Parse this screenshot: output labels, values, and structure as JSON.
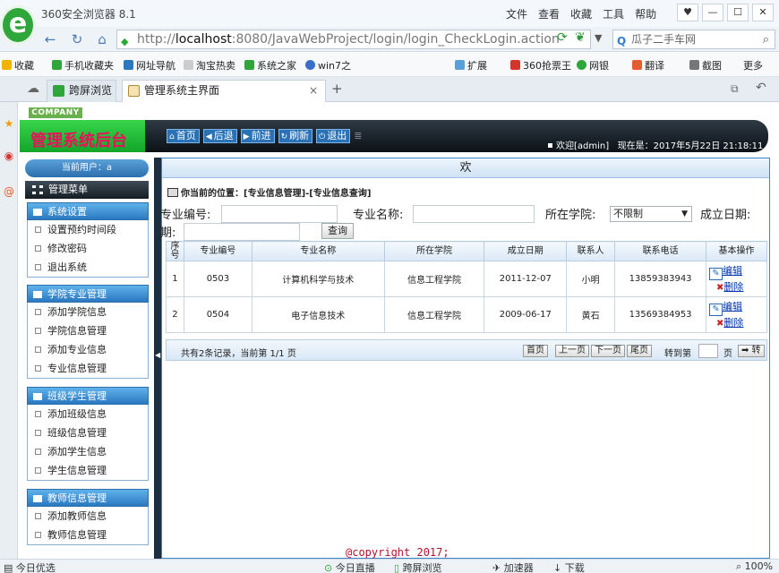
{
  "browser": {
    "app_title": "360安全浏览器 8.1",
    "logo_letter": "e",
    "title_menu": [
      "文件",
      "查看",
      "收藏",
      "工具",
      "帮助"
    ],
    "window_buttons": [
      "♥",
      "—",
      "☐",
      "✕"
    ],
    "address": {
      "scheme": "http://",
      "host": "localhost",
      "rest": ":8080/JavaWebProject/login/login_CheckLogin.action"
    },
    "search_text": "瓜子二手车网",
    "bookmarks": [
      "收藏",
      "手机收藏夹",
      "网址导航",
      "淘宝热卖",
      "系统之家",
      "win7之",
      "扩展",
      "360抢票王",
      "网银",
      "翻译",
      "截图",
      "更多"
    ],
    "tabs": [
      {
        "label": "跨屏浏览",
        "active": false
      },
      {
        "label": "管理系统主界面",
        "active": true
      }
    ],
    "tab_new": "+",
    "tab_close": "×",
    "status_items": [
      "今日优选",
      "今日直播",
      "跨屏浏览",
      "加速器",
      "下载",
      "100%"
    ]
  },
  "header": {
    "company": "COMPANY",
    "title": "管理系统后台",
    "nav_buttons": [
      {
        "label": "首页",
        "icon": "home-icon",
        "glyph": "⌂"
      },
      {
        "label": "后退",
        "icon": "arrow-left-icon",
        "glyph": "◀"
      },
      {
        "label": "前进",
        "icon": "arrow-right-icon",
        "glyph": "▶"
      },
      {
        "label": "刷新",
        "icon": "refresh-icon",
        "glyph": "↻"
      },
      {
        "label": "退出",
        "icon": "power-icon",
        "glyph": "⏻"
      }
    ],
    "welcome": "欢迎[admin]",
    "now_label": "现在是：2017年5月22日 21:18:11"
  },
  "sidebar": {
    "current_user": "当前用户：a",
    "menu_title": "管理菜单",
    "groups": [
      {
        "title": "系统设置",
        "items": [
          "设置预约时间段",
          "修改密码",
          "退出系统"
        ]
      },
      {
        "title": "学院专业管理",
        "items": [
          "添加学院信息",
          "学院信息管理",
          "添加专业信息",
          "专业信息管理"
        ]
      },
      {
        "title": "班级学生管理",
        "items": [
          "添加班级信息",
          "班级信息管理",
          "添加学生信息",
          "学生信息管理"
        ]
      },
      {
        "title": "教师信息管理",
        "items": [
          "添加教师信息",
          "教师信息管理"
        ]
      }
    ]
  },
  "content": {
    "marquee": "欢",
    "position": "你当前的位置：[专业信息管理]-[专业信息查询]",
    "search": {
      "code_label": "专业编号:",
      "code_value": "",
      "name_label": "专业名称:",
      "name_value": "",
      "college_label": "所在学院:",
      "college_selected": "不限制",
      "date_label": "成立日期:",
      "date_value": "",
      "query_button": "查询"
    },
    "table": {
      "headers": [
        "序号",
        "专业编号",
        "专业名称",
        "所在学院",
        "成立日期",
        "联系人",
        "联系电话",
        "基本操作"
      ],
      "rows": [
        {
          "no": "1",
          "code": "0503",
          "name": "计算机科学与技术",
          "college": "信息工程学院",
          "date": "2011-12-07",
          "contact": "小明",
          "phone": "13859383943"
        },
        {
          "no": "2",
          "code": "0504",
          "name": "电子信息技术",
          "college": "信息工程学院",
          "date": "2009-06-17",
          "contact": "黄石",
          "phone": "13569384953"
        }
      ],
      "edit_label": "编辑",
      "delete_label": "删除"
    },
    "pager": {
      "info": "共有2条记录，当前第 1/1 页",
      "first": "首页",
      "prev": "上一页",
      "next": "下一页",
      "last": "尾页",
      "goto_label": "转到第",
      "page_unit": "页",
      "go_button": "➡ 转"
    }
  },
  "footer": {
    "copyright": "@copyright 2017;"
  }
}
